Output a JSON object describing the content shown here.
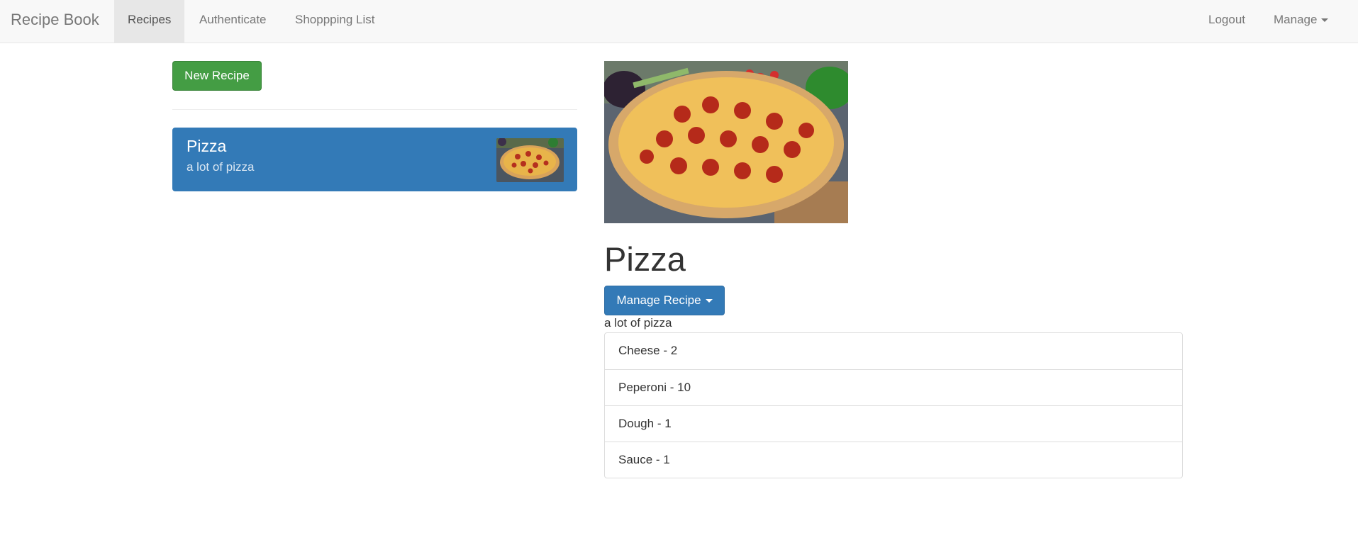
{
  "navbar": {
    "brand": "Recipe Book",
    "links": [
      {
        "label": "Recipes",
        "active": true
      },
      {
        "label": "Authenticate"
      },
      {
        "label": "Shoppping List"
      }
    ],
    "right": {
      "logout": "Logout",
      "manage": "Manage"
    }
  },
  "sidebar": {
    "new_recipe_label": "New Recipe",
    "recipes": [
      {
        "name": "Pizza",
        "description": "a lot of pizza"
      }
    ]
  },
  "detail": {
    "name": "Pizza",
    "manage_label": "Manage Recipe",
    "description": "a lot of pizza",
    "ingredients": [
      {
        "text": "Cheese - 2"
      },
      {
        "text": "Peperoni - 10"
      },
      {
        "text": "Dough - 1"
      },
      {
        "text": "Sauce - 1"
      }
    ]
  },
  "colors": {
    "primary": "#337ab7",
    "success": "#449d44",
    "navbar_bg": "#f8f8f8"
  }
}
